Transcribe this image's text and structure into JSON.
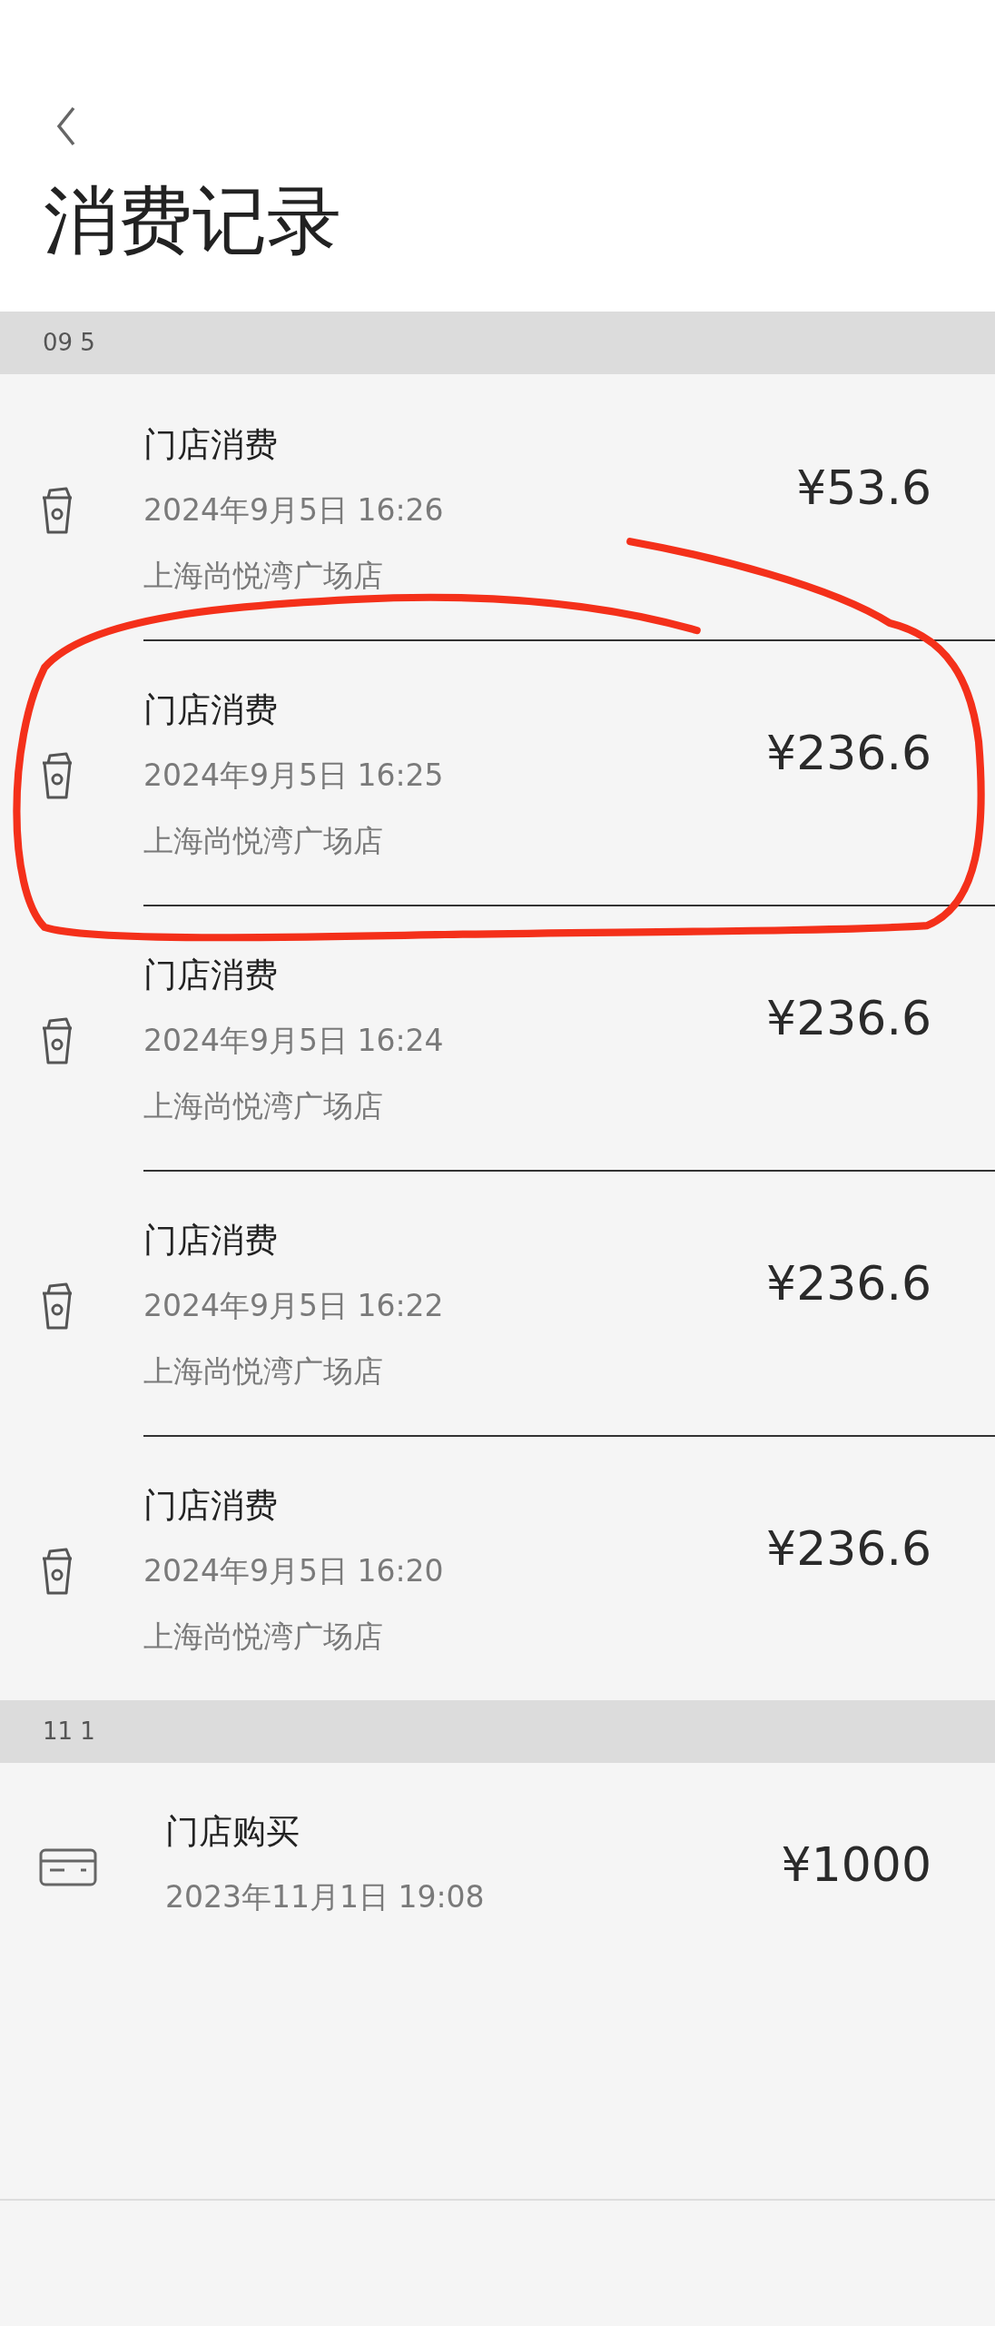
{
  "title": "消费记录",
  "sections": [
    {
      "label": "09 5",
      "records": [
        {
          "kind": "cup",
          "title": "门店消费",
          "datetime": "2024年9月5日 16:26",
          "store": "上海尚悦湾广场店",
          "amount": "¥53.6"
        },
        {
          "kind": "cup",
          "title": "门店消费",
          "datetime": "2024年9月5日 16:25",
          "store": "上海尚悦湾广场店",
          "amount": "¥236.6"
        },
        {
          "kind": "cup",
          "title": "门店消费",
          "datetime": "2024年9月5日 16:24",
          "store": "上海尚悦湾广场店",
          "amount": "¥236.6"
        },
        {
          "kind": "cup",
          "title": "门店消费",
          "datetime": "2024年9月5日 16:22",
          "store": "上海尚悦湾广场店",
          "amount": "¥236.6"
        },
        {
          "kind": "cup",
          "title": "门店消费",
          "datetime": "2024年9月5日 16:20",
          "store": "上海尚悦湾广场店",
          "amount": "¥236.6"
        }
      ]
    },
    {
      "label": "11 1",
      "records": [
        {
          "kind": "card",
          "title": "门店购买",
          "datetime": "2023年11月1日 19:08",
          "amount": "¥1000"
        }
      ]
    }
  ]
}
